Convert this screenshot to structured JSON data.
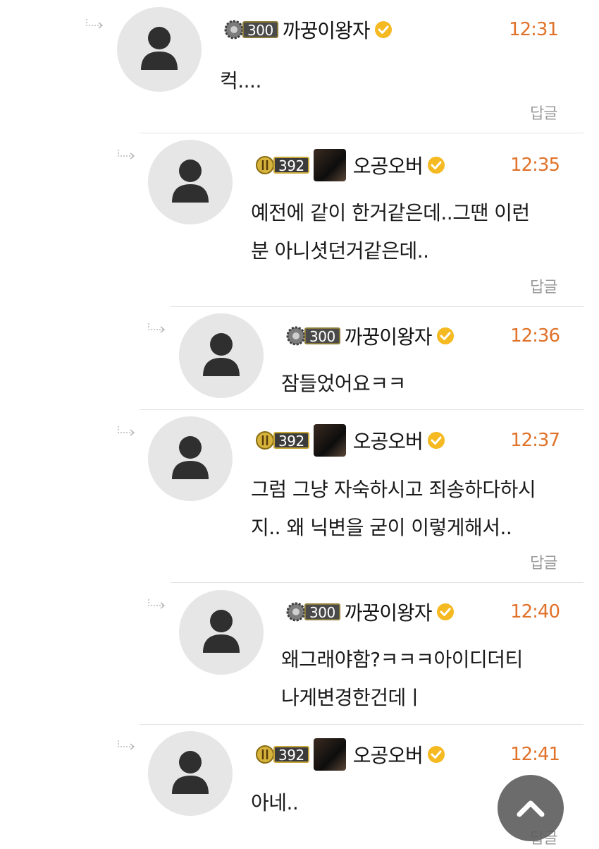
{
  "comments": [
    {
      "nickname": "까꿍이왕자",
      "level": "300",
      "badge_style": "silver",
      "has_profile_photo": false,
      "time": "12:31",
      "text_lines": [
        "컥...."
      ],
      "reply_label": "답글"
    },
    {
      "nickname": "오공오버",
      "level": "392",
      "badge_style": "gold",
      "has_profile_photo": true,
      "time": "12:35",
      "text_lines": [
        "예전에 같이 한거같은데..그땐 이런",
        "분 아니셧던거같은데.."
      ],
      "reply_label": "답글"
    },
    {
      "nickname": "까꿍이왕자",
      "level": "300",
      "badge_style": "silver",
      "has_profile_photo": false,
      "time": "12:36",
      "text_lines": [
        "잠들었어요ㅋㅋ"
      ],
      "reply_label": ""
    },
    {
      "nickname": "오공오버",
      "level": "392",
      "badge_style": "gold",
      "has_profile_photo": true,
      "time": "12:37",
      "text_lines": [
        "그럼 그냥 자숙하시고 죄송하다하시",
        "지.. 왜 닉변을 굳이 이렇게해서.."
      ],
      "reply_label": "답글"
    },
    {
      "nickname": "까꿍이왕자",
      "level": "300",
      "badge_style": "silver",
      "has_profile_photo": false,
      "time": "12:40",
      "text_lines": [
        "왜그래야함?ㅋㅋㅋ아이디더티",
        "나게변경한건데ㅣ"
      ],
      "reply_label": ""
    },
    {
      "nickname": "오공오버",
      "level": "392",
      "badge_style": "gold",
      "has_profile_photo": true,
      "time": "12:41",
      "text_lines": [
        "아네.."
      ],
      "reply_label": "답글"
    }
  ],
  "icons": {
    "reply_arrow": "reply-arrow-icon",
    "avatar": "default-user-icon",
    "verified": "verified-check-icon",
    "scroll_top": "chevron-up-icon"
  },
  "colors": {
    "time": "#e0722a",
    "verified": "#f5b921",
    "divider": "#e2e2e2",
    "reply_label": "#9b9b9b",
    "top_button": "#5f5f5f"
  }
}
